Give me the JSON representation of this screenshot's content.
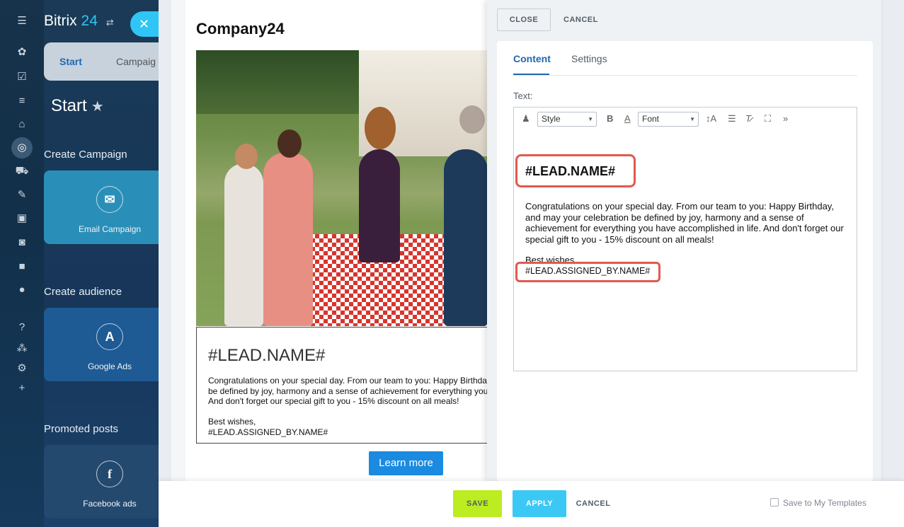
{
  "nav": {
    "icons": [
      "menu-icon",
      "activity-icon",
      "tasks-icon",
      "filter-icon",
      "building-icon",
      "marketing-icon",
      "cart-icon",
      "pen-icon",
      "contact-card-icon",
      "robot-icon",
      "box-icon",
      "check-circle-icon",
      "help-icon",
      "sitemap-icon",
      "gear-icon",
      "plus-icon"
    ]
  },
  "crm": {
    "brand_a": "Bitrix",
    "brand_b": "24",
    "close_symbol": "✕",
    "tabs": [
      "Start",
      "Campaig"
    ],
    "title": "Start",
    "create_campaign": "Create Campaign",
    "email_campaign": "Email Campaign",
    "create_audience": "Create audience",
    "google_ads": "Google Ads",
    "promoted_posts": "Promoted posts",
    "facebook_ads": "Facebook ads",
    "colors": {
      "accent": "#2fc6f6",
      "tile_email": "#2a8fb8",
      "tile_google": "#1e5a93",
      "tile_fb": "#24496f"
    }
  },
  "preview": {
    "company": "Company24",
    "heading": "#LEAD.NAME#",
    "body_lines": [
      "Congratulations on your special day. From our team to you: Happy Birthday",
      "be defined by joy, harmony and a sense of achievement for everything you",
      "And don't forget our special gift to you - 15% discount on all meals!"
    ],
    "sign_off": "Best wishes,",
    "signature": "#LEAD.ASSIGNED_BY.NAME#",
    "learn_more": "Learn more"
  },
  "editor": {
    "close": "CLOSE",
    "cancel": "CANCEL",
    "tabs": {
      "content": "Content",
      "settings": "Settings"
    },
    "text_label": "Text:",
    "toolbar": {
      "style": "Style",
      "font": "Font"
    },
    "heading": "#LEAD.NAME#",
    "body": "Congratulations on your special day. From our team to you: Happy Birthday, and may your celebration be defined by joy, harmony and a sense of achievement for everything you have accomplished in life. And don't forget our special gift to you - 15% discount on all meals!",
    "sign_off": "Best wishes,",
    "signature": "#LEAD.ASSIGNED_BY.NAME#",
    "highlight_color": "#e05a4e"
  },
  "footer": {
    "save": "SAVE",
    "apply": "APPLY",
    "cancel": "CANCEL",
    "save_template": "Save to My Templates",
    "colors": {
      "save": "#bbed21",
      "apply": "#3bc8f5"
    }
  }
}
